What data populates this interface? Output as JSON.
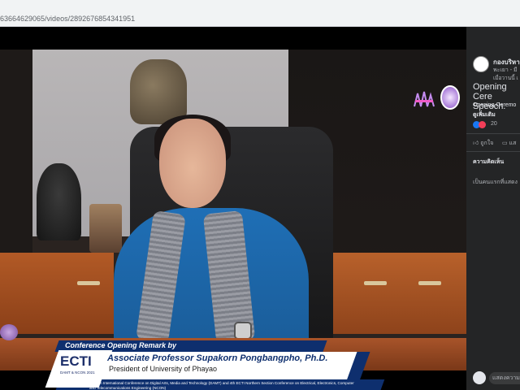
{
  "browser": {
    "url": "63664629065/videos/2892676854341951"
  },
  "video": {
    "banner": {
      "header": "Conference Opening Remark by",
      "name": "Associate Professor Supakorn Pongbangpho, Ph.D.",
      "role": "President of University of Phayao",
      "description": "The 6th International Conference on Digital Arts, Media and Technology (DAMT) and 4th ECTI Northern Section Conference on Electrical, Electronics, Computer and Telecommunications Engineering (NCON)",
      "logo_text": "ECTI",
      "logo_sub": "DAMT & NCON 2021"
    }
  },
  "sidebar": {
    "page_name": "กองบริหาร",
    "page_sub": "พะเยา - มี",
    "page_date": "เมื่อวานนี้ เ",
    "post_title": "Opening Cere Speech.",
    "post_body": "Opening Ceremo",
    "see_more": "ดูเพิ่มเติม",
    "reaction_count": "20",
    "like_label": "ถูกใจ",
    "comment_label": "แส",
    "comments_heading": "ความคิดเห็น",
    "comments_empty": "เป็นคนแรกที่แสดง",
    "comment_placeholder": "แสดงความ"
  }
}
